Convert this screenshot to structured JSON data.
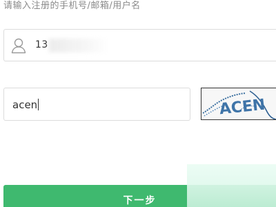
{
  "prompt": {
    "text": "请输入注册的手机号/邮箱/用户名"
  },
  "account_field": {
    "value": "13",
    "icon": "user-icon"
  },
  "captcha_field": {
    "value": "acen"
  },
  "captcha_image": {
    "text": "ACEN"
  },
  "next_button": {
    "label": "下一步"
  },
  "colors": {
    "accent": "#3fb96f",
    "border": "#dcdcdc",
    "prompt_text": "#8a8a8a",
    "input_text": "#333333"
  }
}
